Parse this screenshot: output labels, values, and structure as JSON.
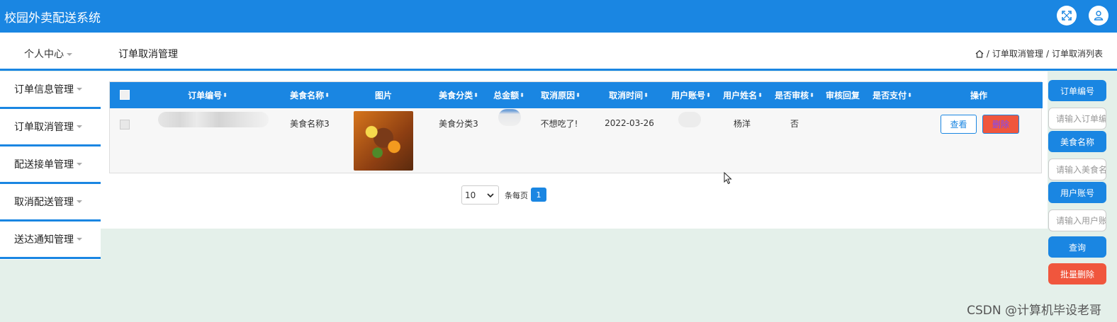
{
  "app": {
    "title": "校园外卖配送系统"
  },
  "header": {
    "expand_icon": "fullscreen-icon",
    "user_icon": "user-icon"
  },
  "subbar": {
    "user_center": "个人中心",
    "page_title": "订单取消管理",
    "breadcrumb": [
      "订单取消管理",
      "订单取消列表"
    ]
  },
  "sidebar": {
    "items": [
      {
        "label": "订单信息管理"
      },
      {
        "label": "订单取消管理"
      },
      {
        "label": "配送接单管理"
      },
      {
        "label": "取消配送管理"
      },
      {
        "label": "送达通知管理"
      }
    ]
  },
  "table": {
    "columns": [
      "订单编号",
      "美食名称",
      "图片",
      "美食分类",
      "总金额",
      "取消原因",
      "取消时间",
      "用户账号",
      "用户姓名",
      "是否审核",
      "审核回复",
      "是否支付",
      "操作"
    ],
    "rows": [
      {
        "order_no": "",
        "food_name": "美食名称3",
        "food_category": "美食分类3",
        "total": "",
        "reason": "不想吃了!",
        "cancel_time": "2022-03-26",
        "account": "",
        "user_name": "杨洋",
        "reviewed": "否",
        "reply": "",
        "paid": "",
        "view_label": "查看",
        "delete_label": "删除"
      }
    ]
  },
  "pagination": {
    "page_size": "10",
    "per_page_label": "条每页",
    "current_page": "1"
  },
  "search": {
    "order_no_label": "订单编号",
    "order_no_placeholder": "请输入订单编号",
    "food_name_label": "美食名称",
    "food_name_placeholder": "请输入美食名称",
    "account_label": "用户账号",
    "account_placeholder": "请输入用户账号",
    "query_label": "查询",
    "batch_delete_label": "批量删除"
  },
  "watermark": "CSDN @计算机毕设老哥",
  "colors": {
    "primary": "#1a86e2",
    "danger": "#f0563d",
    "background": "#e4f0ea"
  }
}
